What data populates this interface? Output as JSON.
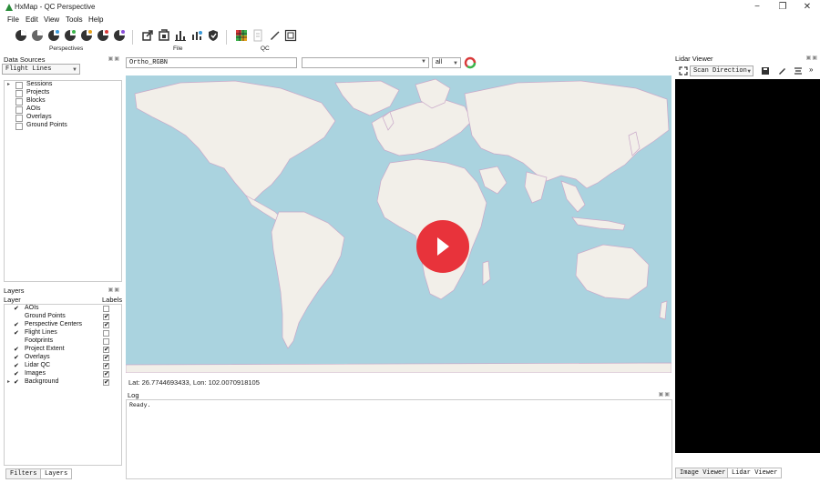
{
  "window": {
    "title": "HxMap - QC Perspective",
    "minimize": "−",
    "restore": "❐",
    "close": "✕"
  },
  "menu": [
    "File",
    "Edit",
    "View",
    "Tools",
    "Help"
  ],
  "toolbar": {
    "groups": [
      "Perspectives",
      "File",
      "QC"
    ]
  },
  "data_sources": {
    "title": "Data Sources",
    "combo_value": "Flight Lines",
    "items": [
      "Sessions",
      "Projects",
      "Blocks",
      "AOIs",
      "Overlays",
      "Ground Points"
    ]
  },
  "layers": {
    "title": "Layers",
    "col_layer": "Layer",
    "col_labels": "Labels",
    "rows": [
      {
        "name": "AOIs",
        "visible": "✔",
        "label": ""
      },
      {
        "name": "Ground Points",
        "visible": "",
        "label": "✔"
      },
      {
        "name": "Perspective Centers",
        "visible": "✔",
        "label": "✔"
      },
      {
        "name": "Flight Lines",
        "visible": "✔",
        "label": ""
      },
      {
        "name": "Footprints",
        "visible": "",
        "label": ""
      },
      {
        "name": "Project Extent",
        "visible": "✔",
        "label": "✔"
      },
      {
        "name": "Overlays",
        "visible": "✔",
        "label": "✔"
      },
      {
        "name": "Lidar QC",
        "visible": "✔",
        "label": "✔"
      },
      {
        "name": "Images",
        "visible": "✔",
        "label": "✔"
      },
      {
        "name": "Background",
        "visible": "✔",
        "label": "✔"
      }
    ]
  },
  "left_tabs": [
    "Filters",
    "Layers"
  ],
  "map_toolbar": {
    "ortho_value": "Ortho_RGBN",
    "layer_value": "",
    "filter_value": "all"
  },
  "status": {
    "coords": "Lat: 26.7744693433, Lon: 102.0070918105"
  },
  "log": {
    "title": "Log",
    "text": "Ready."
  },
  "lidar": {
    "title": "Lidar Viewer",
    "scan_value": "Scan Direction",
    "more": "»"
  },
  "right_tabs": [
    "Image Viewer",
    "Lidar Viewer"
  ],
  "colors": {
    "water": "#aad3df",
    "land": "#f2efe9",
    "border": "#c9a8c9",
    "play": "#e8333b"
  }
}
